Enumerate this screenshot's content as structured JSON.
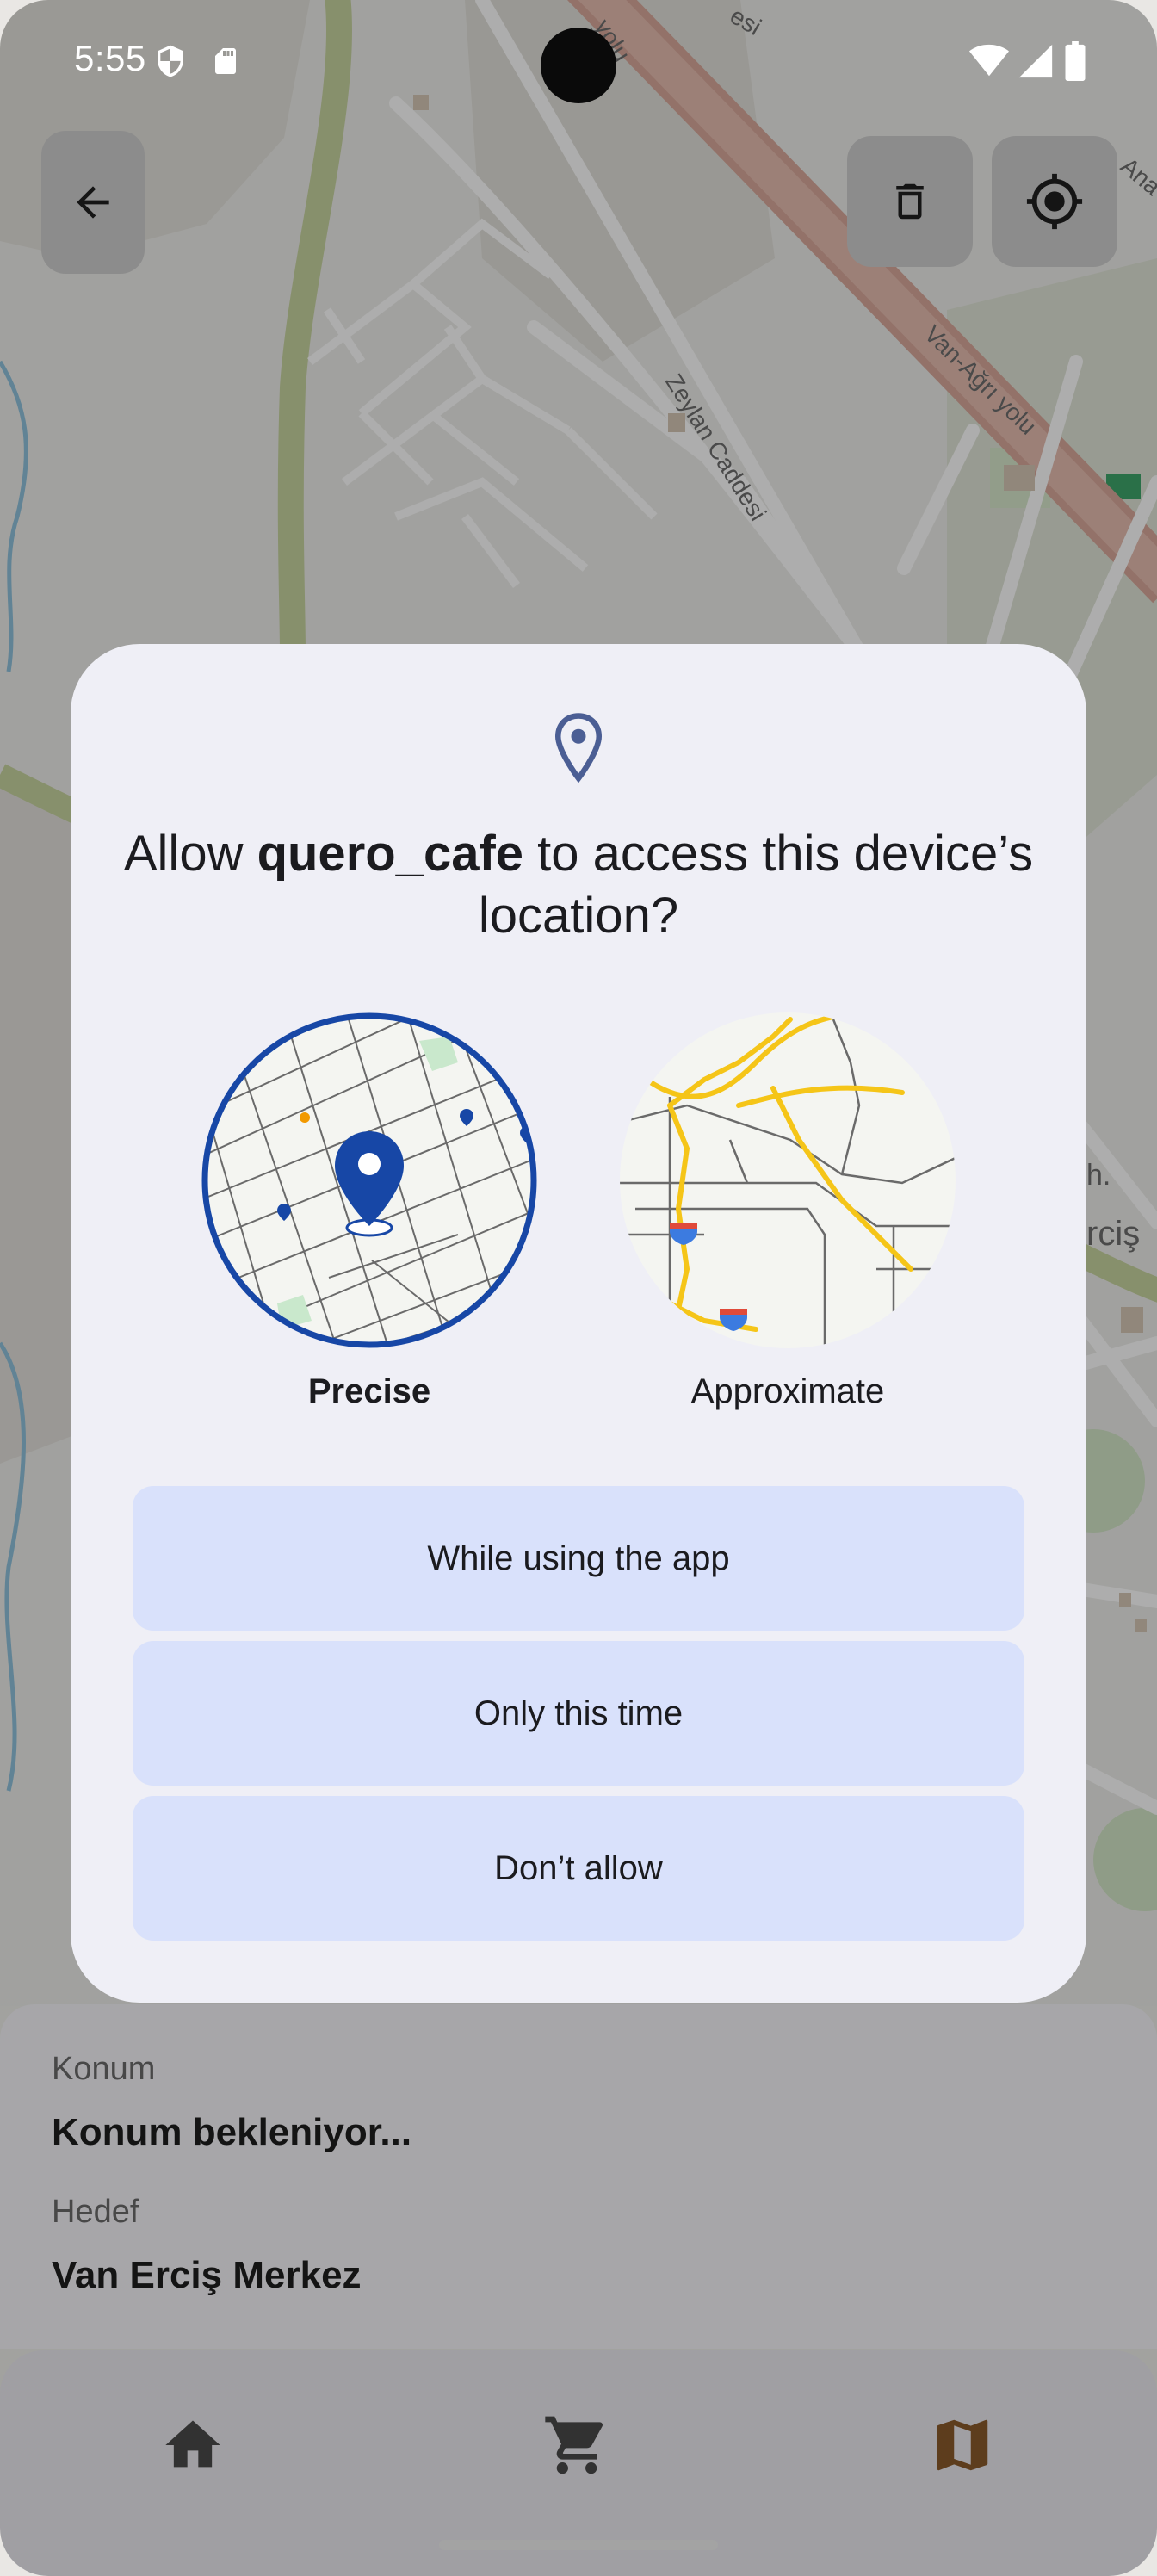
{
  "status_bar": {
    "time": "5:55"
  },
  "map": {
    "street_labels": [
      "Zeylan Caddesi",
      "Van-Ağrı yolu",
      "yolu",
      "yolu",
      "Ana",
      "esi"
    ],
    "partial_labels": [
      "h.",
      "rciş"
    ]
  },
  "map_controls": {
    "back_icon": "arrow-back-icon",
    "delete_icon": "trash-icon",
    "locate_icon": "my-location-icon"
  },
  "dialog": {
    "icon": "location-pin-icon",
    "title_prefix": "Allow ",
    "title_app": "quero_cafe",
    "title_suffix": " to access this device’s location?",
    "options": {
      "precise": "Precise",
      "approximate": "Approximate"
    },
    "buttons": {
      "while_using": "While using the app",
      "only_this_time": "Only this time",
      "dont_allow": "Don’t allow"
    },
    "selected_option": "Precise"
  },
  "sheet": {
    "location_label": "Konum",
    "location_value": "Konum bekleniyor...",
    "target_label": "Hedef",
    "target_value": "Van Erciş Merkez"
  },
  "nav": {
    "items": [
      "home-icon",
      "cart-icon",
      "map-icon"
    ],
    "active": "map-icon"
  },
  "colors": {
    "accent_blue": "#1747a6",
    "button_bg": "#d9e1fb",
    "dialog_bg": "#efeff6",
    "road_highlight": "#d08a7a",
    "map_active": "#8a5a2b"
  }
}
